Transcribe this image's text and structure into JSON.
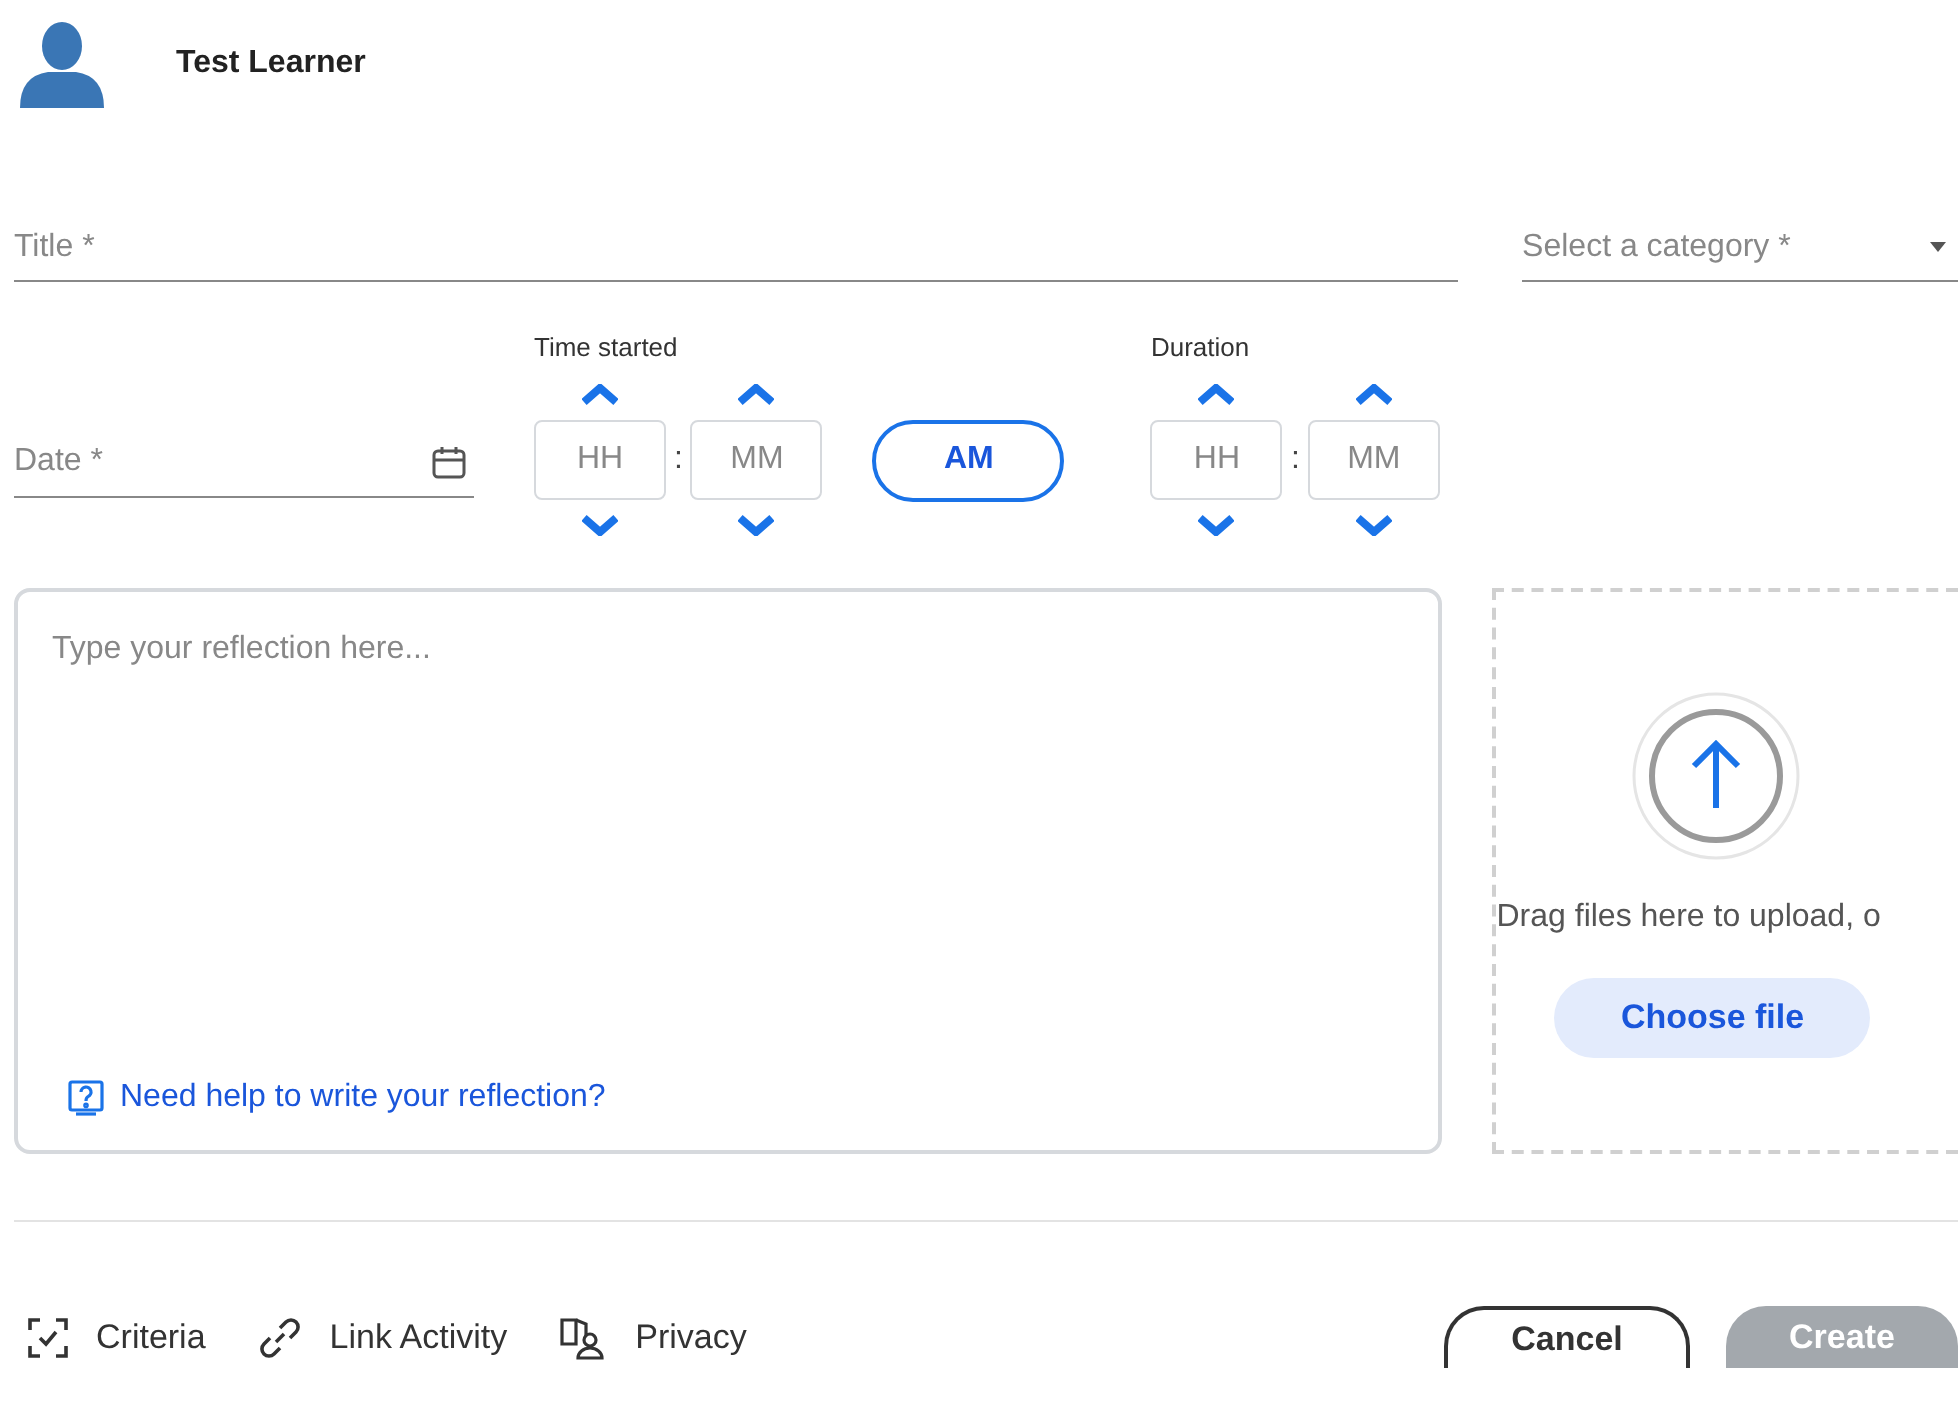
{
  "user": {
    "name": "Test Learner"
  },
  "title_field": {
    "placeholder": "Title *"
  },
  "category_select": {
    "placeholder": "Select a category *"
  },
  "date_field": {
    "placeholder": "Date *"
  },
  "time_started": {
    "label": "Time started",
    "hours": {
      "placeholder": "HH"
    },
    "separator": ":",
    "minutes": {
      "placeholder": "MM"
    },
    "meridiem": "AM"
  },
  "duration": {
    "label": "Duration",
    "hours": {
      "placeholder": "HH"
    },
    "separator": ":",
    "minutes": {
      "placeholder": "MM"
    }
  },
  "reflection": {
    "placeholder": "Type your reflection here...",
    "help_link": "Need help to write your reflection?"
  },
  "upload": {
    "text": "Drag files here to upload, o",
    "button": "Choose file"
  },
  "footer_actions": [
    {
      "kind": "criteria",
      "label": "Criteria"
    },
    {
      "kind": "link",
      "label": "Link Activity"
    },
    {
      "kind": "privacy",
      "label": "Privacy"
    }
  ],
  "buttons": [
    {
      "label": "Cancel",
      "disabled": false
    },
    {
      "label": "Create",
      "disabled": true
    }
  ]
}
